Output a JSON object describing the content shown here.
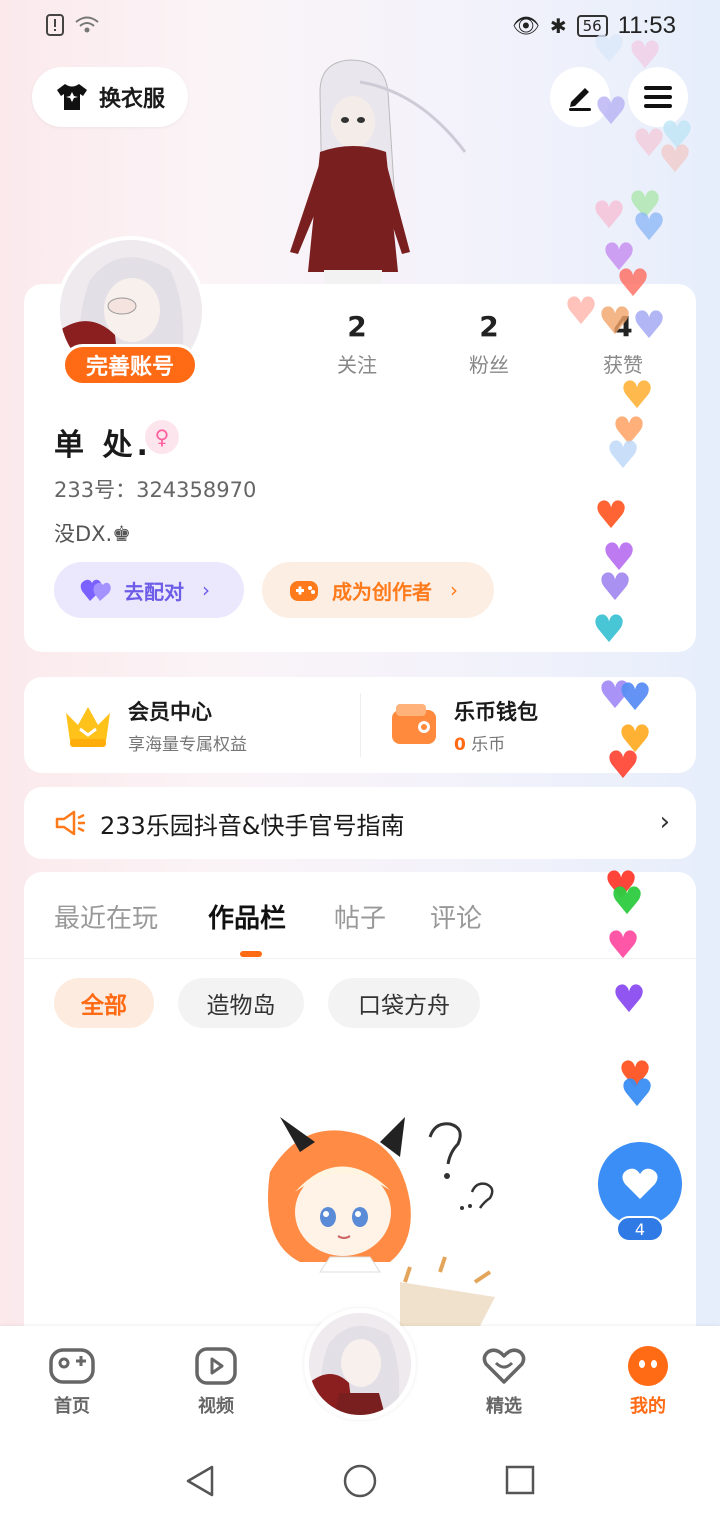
{
  "status_bar": {
    "battery": "56",
    "time": "11:53"
  },
  "header": {
    "outfit_label": "换衣服"
  },
  "profile": {
    "complete_account_label": "完善账号",
    "username": "单 处.",
    "gender_symbol": "♀",
    "id_text": "233号：324358970",
    "signature": "没DX.♚",
    "stats": [
      {
        "value": "2",
        "label": "关注"
      },
      {
        "value": "2",
        "label": "粉丝"
      },
      {
        "value": "4",
        "label": "获赞"
      }
    ],
    "match_label": "去配对",
    "creator_label": "成为创作者"
  },
  "member": {
    "title": "会员中心",
    "subtitle": "享海量专属权益",
    "wallet_title": "乐币钱包",
    "wallet_amount": "0",
    "wallet_unit": "乐币"
  },
  "notice": {
    "text": "233乐园抖音&快手官号指南"
  },
  "works": {
    "tabs": [
      "最近在玩",
      "作品栏",
      "帖子",
      "评论"
    ],
    "active_tab": "作品栏",
    "filters": [
      "全部",
      "造物岛",
      "口袋方舟"
    ],
    "active_filter": "全部"
  },
  "like_fab": {
    "count": "4"
  },
  "bottom_nav": {
    "items": [
      "首页",
      "视频",
      "精选",
      "我的"
    ],
    "active": "我的"
  },
  "colors": {
    "accent": "#ff6a14",
    "purple": "#6c5ce7",
    "blue_fab": "#3a8ef6"
  },
  "icons": [
    "shirt-icon",
    "edit-icon",
    "menu-icon",
    "heart-icon",
    "gamepad-icon",
    "crown-icon",
    "wallet-icon",
    "megaphone-icon",
    "video-icon",
    "featured-icon",
    "face-icon"
  ]
}
